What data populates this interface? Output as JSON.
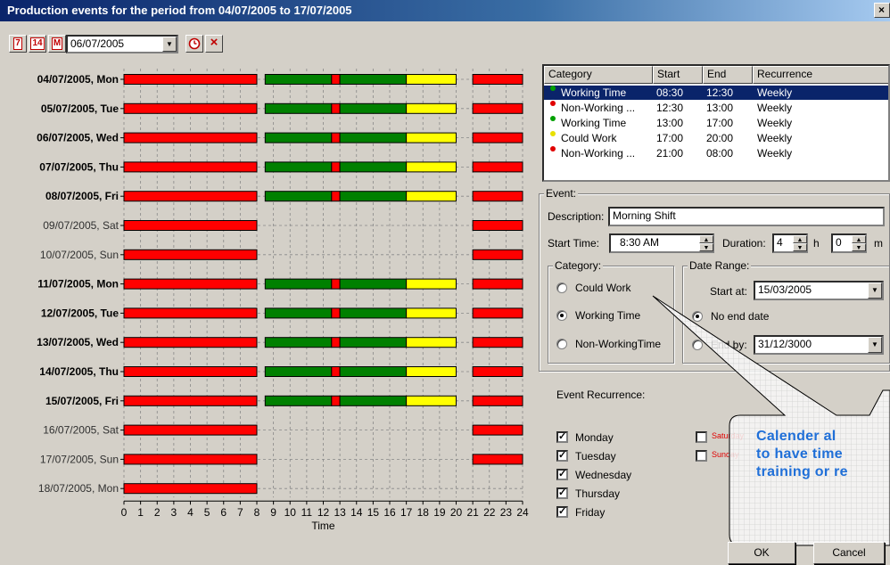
{
  "window": {
    "title": "Production events for the period from 04/07/2005 to 17/07/2005",
    "close_label": "×"
  },
  "toolbar": {
    "day_view_label": "7",
    "week_view_label": "14",
    "month_view_label": "M",
    "date_value": "06/07/2005",
    "combo_arrow": "▼",
    "clock_icon": "clock-icon",
    "delete_label": "×"
  },
  "chart_data": {
    "type": "gantt",
    "xlabel": "Time",
    "xlim": [
      0,
      24
    ],
    "x_ticks": [
      0,
      1,
      2,
      3,
      4,
      5,
      6,
      7,
      8,
      9,
      10,
      11,
      12,
      13,
      14,
      15,
      16,
      17,
      18,
      19,
      20,
      21,
      22,
      23,
      24
    ],
    "grid": "dashed",
    "colors": {
      "non_working": "#ff0000",
      "working": "#008000",
      "could_work": "#ffff00",
      "divider": "#000000"
    },
    "rows": [
      {
        "label": "04/07/2005, Mon",
        "bold": true,
        "weekday": true
      },
      {
        "label": "05/07/2005, Tue",
        "bold": true,
        "weekday": true
      },
      {
        "label": "06/07/2005, Wed",
        "bold": true,
        "weekday": true
      },
      {
        "label": "07/07/2005, Thu",
        "bold": true,
        "weekday": true
      },
      {
        "label": "08/07/2005, Fri",
        "bold": true,
        "weekday": true
      },
      {
        "label": "09/07/2005, Sat",
        "bold": false,
        "weekday": false
      },
      {
        "label": "10/07/2005, Sun",
        "bold": false,
        "weekday": false
      },
      {
        "label": "11/07/2005, Mon",
        "bold": true,
        "weekday": true
      },
      {
        "label": "12/07/2005, Tue",
        "bold": true,
        "weekday": true
      },
      {
        "label": "13/07/2005, Wed",
        "bold": true,
        "weekday": true
      },
      {
        "label": "14/07/2005, Thu",
        "bold": true,
        "weekday": true
      },
      {
        "label": "15/07/2005, Fri",
        "bold": true,
        "weekday": true
      },
      {
        "label": "16/07/2005, Sat",
        "bold": false,
        "weekday": false
      },
      {
        "label": "17/07/2005, Sun",
        "bold": false,
        "weekday": false
      },
      {
        "label": "18/07/2005, Mon",
        "bold": false,
        "weekday": false,
        "partial": true
      }
    ],
    "weekday_segments": [
      {
        "start": 0,
        "end": 8,
        "kind": "non_working"
      },
      {
        "start": 8.5,
        "end": 12.5,
        "kind": "working"
      },
      {
        "start": 12.5,
        "end": 13,
        "kind": "non_working"
      },
      {
        "start": 13,
        "end": 17,
        "kind": "working"
      },
      {
        "start": 17,
        "end": 20,
        "kind": "could_work"
      },
      {
        "start": 21,
        "end": 24,
        "kind": "non_working"
      }
    ],
    "weekend_segments": [
      {
        "start": 0,
        "end": 8,
        "kind": "non_working"
      },
      {
        "start": 21,
        "end": 24,
        "kind": "non_working"
      }
    ],
    "partial_segments": [
      {
        "start": 0,
        "end": 8,
        "kind": "non_working"
      }
    ]
  },
  "events_table": {
    "headers": [
      "Category",
      "Start",
      "End",
      "Recurrence"
    ],
    "rows": [
      {
        "category": "Working Time",
        "start": "08:30",
        "end": "12:30",
        "recurrence": "Weekly",
        "color": "#00a000",
        "selected": true
      },
      {
        "category": "Non-Working ...",
        "start": "12:30",
        "end": "13:00",
        "recurrence": "Weekly",
        "color": "#e00000",
        "selected": false
      },
      {
        "category": "Working Time",
        "start": "13:00",
        "end": "17:00",
        "recurrence": "Weekly",
        "color": "#00a000",
        "selected": false
      },
      {
        "category": "Could Work",
        "start": "17:00",
        "end": "20:00",
        "recurrence": "Weekly",
        "color": "#e8e000",
        "selected": false
      },
      {
        "category": "Non-Working ...",
        "start": "21:00",
        "end": "08:00",
        "recurrence": "Weekly",
        "color": "#e00000",
        "selected": false
      }
    ]
  },
  "event": {
    "group_label": "Event:",
    "description_label": "Description:",
    "description_value": "Morning Shift",
    "start_time_label": "Start Time:",
    "start_time_value": "8:30 AM",
    "duration_label": "Duration:",
    "duration_hours": "4",
    "hours_unit": "h",
    "duration_minutes": "0",
    "minutes_unit": "m"
  },
  "category": {
    "group_label": "Category:",
    "options": [
      "Could Work",
      "Working Time",
      "Non-WorkingTime"
    ],
    "selected": "Working Time"
  },
  "date_range": {
    "group_label": "Date Range:",
    "start_label": "Start at:",
    "start_value": "15/03/2005",
    "no_end_label": "No end date",
    "end_by_label": "End by:",
    "end_by_value": "31/12/3000"
  },
  "recurrence": {
    "label": "Event Recurrence:",
    "days": [
      {
        "label": "Monday",
        "checked": true
      },
      {
        "label": "Tuesday",
        "checked": true
      },
      {
        "label": "Wednesday",
        "checked": true
      },
      {
        "label": "Thursday",
        "checked": true
      },
      {
        "label": "Friday",
        "checked": true
      }
    ],
    "weekend": [
      {
        "label": "Saturday",
        "checked": false
      },
      {
        "label": "Sunday",
        "checked": false
      }
    ]
  },
  "buttons": {
    "ok_label": "OK",
    "cancel_label": "Cancel"
  },
  "callout": {
    "line1": "Calender al",
    "line2": "to have time",
    "line3": "training or re"
  }
}
